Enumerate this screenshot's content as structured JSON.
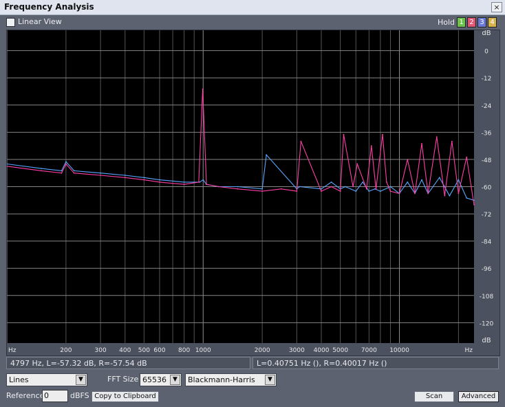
{
  "window": {
    "title": "Frequency Analysis",
    "close_glyph": "×"
  },
  "toolbar": {
    "linear_view_label": "Linear View",
    "hold_label": "Hold",
    "hold_buttons": [
      "1",
      "2",
      "3",
      "4"
    ]
  },
  "colors": {
    "hold_1": "#6cc24a",
    "hold_2": "#e05573",
    "hold_3": "#6a78d6",
    "hold_4": "#d5b24a",
    "left_channel": "#58a8ff",
    "right_channel": "#ff3fa6",
    "grid": "#888888"
  },
  "graph": {
    "y_unit": "dB",
    "y_ticks": [
      "0",
      "-12",
      "-24",
      "-36",
      "-48",
      "-60",
      "-72",
      "-84",
      "-96",
      "-108",
      "-120"
    ],
    "x_unit": "Hz",
    "x_ticks": [
      "200",
      "300",
      "400",
      "500",
      "600",
      "800",
      "1000",
      "2000",
      "3000",
      "4000",
      "5000",
      "7000",
      "10000"
    ]
  },
  "chart_data": {
    "type": "line",
    "title": "",
    "xlabel": "Hz",
    "ylabel": "dB",
    "xscale": "log",
    "xlim": [
      100,
      24000
    ],
    "ylim": [
      -129,
      9
    ],
    "grid": true,
    "series": [
      {
        "x": [
          100,
          150,
          190,
          200,
          220,
          300,
          400,
          500,
          600,
          800,
          960,
          1000,
          1040,
          1200,
          1500,
          2000,
          2100,
          3000,
          3100,
          4000,
          4500,
          5000,
          5300,
          6000,
          6500,
          7000,
          7500,
          8000,
          9000,
          10000,
          11000,
          12000,
          13000,
          14000,
          16000,
          18000,
          20000,
          22000,
          24000
        ],
        "y": [
          -50,
          -52,
          -53,
          -49,
          -53,
          -54,
          -55,
          -56,
          -57,
          -58,
          -58,
          -57,
          -59,
          -60,
          -60,
          -61,
          -46,
          -61,
          -60,
          -61,
          -58,
          -61,
          -60,
          -62,
          -58,
          -62,
          -61,
          -62,
          -60,
          -63,
          -58,
          -63,
          -57,
          -63,
          -56,
          -64,
          -57,
          -65,
          -66
        ]
      },
      {
        "x": [
          100,
          150,
          190,
          200,
          220,
          300,
          400,
          500,
          600,
          800,
          950,
          995,
          1040,
          1200,
          1500,
          2000,
          2500,
          3000,
          3150,
          4000,
          4500,
          5000,
          5200,
          5800,
          6100,
          6800,
          7200,
          7600,
          8200,
          8600,
          9000,
          10000,
          11000,
          12000,
          13000,
          14000,
          15500,
          17000,
          18500,
          20000,
          22000,
          24000
        ],
        "y": [
          -51,
          -53,
          -54,
          -50,
          -54,
          -55,
          -56,
          -57,
          -58,
          -59,
          -58,
          -17,
          -59,
          -60,
          -61,
          -62,
          -61,
          -62,
          -40,
          -62,
          -60,
          -62,
          -37,
          -60,
          -50,
          -61,
          -42,
          -61,
          -37,
          -58,
          -62,
          -63,
          -48,
          -63,
          -41,
          -63,
          -38,
          -64,
          -40,
          -63,
          -47,
          -68
        ]
      }
    ]
  },
  "status": {
    "cursor_readout": "4797 Hz, L=-57.32 dB, R=-57.54 dB",
    "channel_readout": "L=0.40751 Hz (), R=0.40017 Hz ()"
  },
  "controls": {
    "display_mode": "Lines",
    "fft_size_label": "FFT Size",
    "fft_size": "65536",
    "window_function": "Blackmann-Harris",
    "reference_label": "Reference",
    "reference_value": "0",
    "reference_unit": "dBFS",
    "copy_label": "Copy to Clipboard",
    "scan_label": "Scan",
    "advanced_label": "Advanced"
  }
}
